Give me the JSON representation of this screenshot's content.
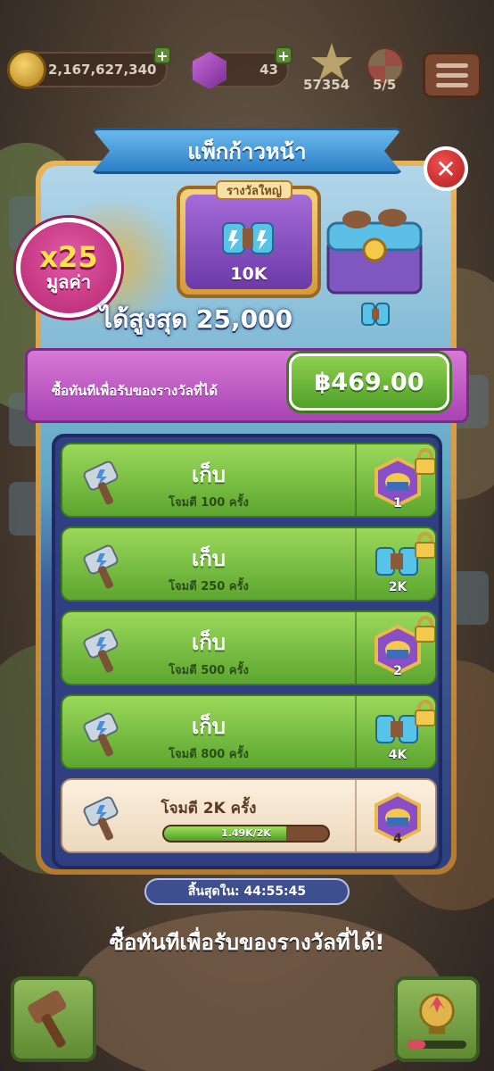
{
  "topbar": {
    "coins": "2,167,627,340",
    "gems": "43",
    "stars": "57354",
    "spins": "5/5"
  },
  "panel": {
    "title": "แพ็กก้าวหน้า",
    "grand_prize_label": "รางวัลใหญ่",
    "grand_prize_amount": "10K",
    "multiplier": "x25",
    "multiplier_label": "มูลค่า",
    "max_text": "ได้สูงสุด 25,000",
    "buy_text": "ซื้อทันทีเพื่อรับของรางวัลที่ได้",
    "price": "฿469.00"
  },
  "rows": [
    {
      "collect": "เก็บ",
      "hits": "โจมตี 100 ครั้ง",
      "reward": "1",
      "reward_icon": "gold-chest-icon",
      "locked": true
    },
    {
      "collect": "เก็บ",
      "hits": "โจมตี 250 ครั้ง",
      "reward": "2K",
      "reward_icon": "sledgehammer-icon",
      "locked": true
    },
    {
      "collect": "เก็บ",
      "hits": "โจมตี 500 ครั้ง",
      "reward": "2",
      "reward_icon": "gold-chest-icon",
      "locked": true
    },
    {
      "collect": "เก็บ",
      "hits": "โจมตี 800 ครั้ง",
      "reward": "4K",
      "reward_icon": "sledgehammer-icon",
      "locked": true
    },
    {
      "collect": "",
      "hits": "โจมตี 2K ครั้ง",
      "progress_text": "1.49K/2K",
      "progress": 0.745,
      "reward": "4",
      "reward_icon": "gold-chest-icon",
      "locked": false
    }
  ],
  "timer": "สิ้นสุดใน: 44:55:45",
  "bottom_caption": "ซื้อทันทีเพื่อรับของรางวัลที่ได้!",
  "colors": {
    "accent_green": "#5ca62f",
    "ribbon_blue": "#2c7fc7",
    "badge_pink": "#b5256f",
    "strip_purple": "#a843b3"
  }
}
